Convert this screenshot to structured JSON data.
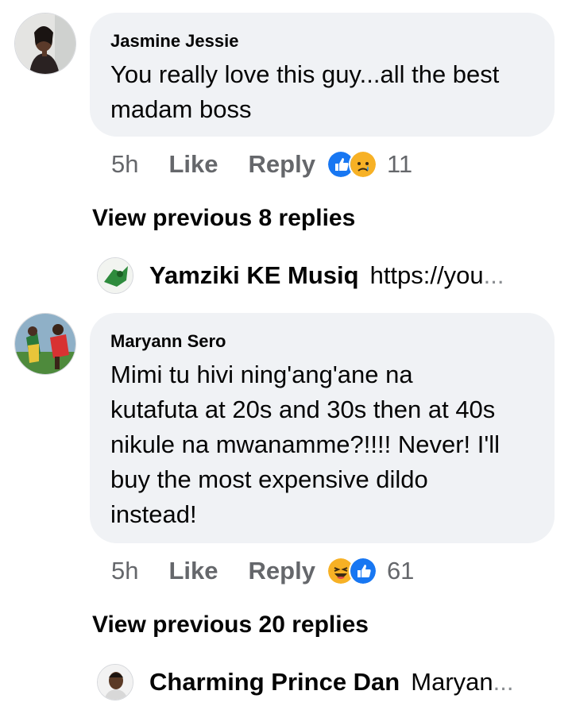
{
  "comments": [
    {
      "author": "Jasmine Jessie",
      "lines": [
        "You really love this guy...all the best",
        "madam boss"
      ],
      "time": "5h",
      "like_label": "Like",
      "reply_label": "Reply",
      "reactions": [
        "like",
        "sad"
      ],
      "reaction_count": "11",
      "view_previous": "View previous 8 replies",
      "latest_reply": {
        "author": "Yamziki KE Musiq",
        "text": "https://you",
        "ellipsis": "..."
      }
    },
    {
      "author": "Maryann Sero",
      "lines": [
        "Mimi tu hivi ning'ang'ane na",
        "kutafuta  at 20s and 30s then at 40s",
        "nikule na mwanamme?!!!! Never! I'll",
        "buy the most expensive dildo",
        "instead!"
      ],
      "time": "5h",
      "like_label": "Like",
      "reply_label": "Reply",
      "reactions": [
        "haha",
        "like"
      ],
      "reaction_count": "61",
      "view_previous": "View previous 20 replies",
      "latest_reply": {
        "author": "Charming Prince Dan",
        "text": "Maryan",
        "ellipsis": "..."
      }
    }
  ],
  "colors": {
    "like_blue": "#1877f2",
    "emoji_yellow": "#f7b125",
    "bubble_bg": "#f0f2f5",
    "meta_gray": "#65676b"
  }
}
